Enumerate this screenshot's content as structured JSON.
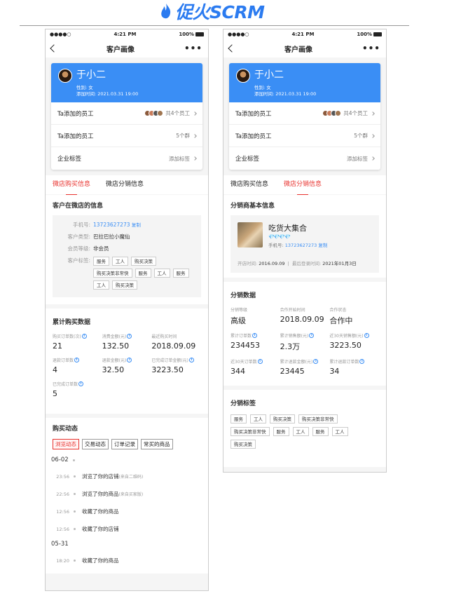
{
  "brand": {
    "name": "促火SCRM"
  },
  "status": {
    "carrier": "●●●●○",
    "wifi": "≋",
    "time": "4:21 PM",
    "battery": "100%"
  },
  "nav": {
    "title": "客户画像",
    "more": "•••"
  },
  "customer": {
    "name": "于小二",
    "gender": "性别: 女",
    "added": "添加时间: 2021.03.31 19:00",
    "rows": [
      {
        "label": "Ta添加的员工",
        "value": "共4个员工"
      },
      {
        "label": "Ta添加的员工",
        "value": "5个群"
      },
      {
        "label": "企业标签",
        "value": "添加标签"
      }
    ]
  },
  "tabs": {
    "buy": "微店购买信息",
    "dist": "微店分销信息"
  },
  "shop_info": {
    "title": "客户在微店的信息",
    "phone_label": "手机号:",
    "phone": "13723627273",
    "copy": "复制",
    "type_label": "客户类型:",
    "type": "巴拉巴拉小魔仙",
    "level_label": "会员等级:",
    "level": "非会员",
    "tags_label": "客户标签:",
    "tags": [
      "服务",
      "工人",
      "购买决策",
      "购买决策非常快",
      "服务",
      "工人",
      "服务",
      "工人",
      "购买决策"
    ]
  },
  "purchase": {
    "title": "累计购买数据",
    "items": [
      {
        "label": "购买订单数(次)",
        "value": "21"
      },
      {
        "label": "消费金额(元)",
        "value": "132.50"
      },
      {
        "label": "最近购买时间",
        "value": "2018.09.09"
      },
      {
        "label": "退款订单数",
        "value": "4"
      },
      {
        "label": "退款金额(元)",
        "value": "32.50"
      },
      {
        "label": "已完成订单金额(元)",
        "value": "3223.50"
      },
      {
        "label": "已完成订单数",
        "value": "5"
      }
    ]
  },
  "activity": {
    "title": "购买动态",
    "filters": [
      "浏览动态",
      "交易动态",
      "订单记录",
      "常买的商品"
    ],
    "groups": [
      {
        "date": "06-02",
        "items": [
          {
            "time": "23:56",
            "text": "浏览了你的店铺",
            "src": "(来自二维码)"
          },
          {
            "time": "22:56",
            "text": "浏览了你的商品",
            "src": "(来自买家版)"
          },
          {
            "time": "12:56",
            "text": "收藏了你的商品",
            "src": ""
          },
          {
            "time": "12:56",
            "text": "收藏了你的店铺",
            "src": ""
          }
        ]
      },
      {
        "date": "05-31",
        "items": [
          {
            "time": "18:20",
            "text": "收藏了你的商品",
            "src": ""
          }
        ]
      }
    ]
  },
  "dist_basic": {
    "title": "分销商基本信息",
    "name": "吃货大集合",
    "gems": "💎💎💎💎",
    "phone_label": "手机号:",
    "phone": "13723627273",
    "copy": "复制",
    "open_label": "开店时间:",
    "open": "2016.09.09",
    "login_label": "最后登录时间:",
    "login": "2021年01月3日"
  },
  "dist_data": {
    "title": "分销数据",
    "items": [
      {
        "label": "分销等级",
        "value": "高级",
        "info": false
      },
      {
        "label": "合作开始时间",
        "value": "2018.09.09",
        "info": false
      },
      {
        "label": "合作状态",
        "value": "合作中",
        "info": false
      },
      {
        "label": "累计订单数",
        "value": "234453",
        "info": true
      },
      {
        "label": "累计销售额(元)",
        "value": "2.3万",
        "info": true
      },
      {
        "label": "近30天销售额(元)",
        "value": "3223.50",
        "info": true
      },
      {
        "label": "近30天订单数",
        "value": "344",
        "info": true
      },
      {
        "label": "累计退款金额(元)",
        "value": "23445",
        "info": true
      },
      {
        "label": "累计退款订单数",
        "value": "34",
        "info": true
      }
    ]
  },
  "dist_tags": {
    "title": "分销标签",
    "tags": [
      "服务",
      "工人",
      "购买决策",
      "购买决策非常快",
      "购买决策非常快",
      "服务",
      "工人",
      "服务",
      "工人",
      "购买决策"
    ]
  },
  "colors": {
    "primary": "#3a8ef5",
    "accent": "#e8322e",
    "brand": "#2b7bf0"
  }
}
